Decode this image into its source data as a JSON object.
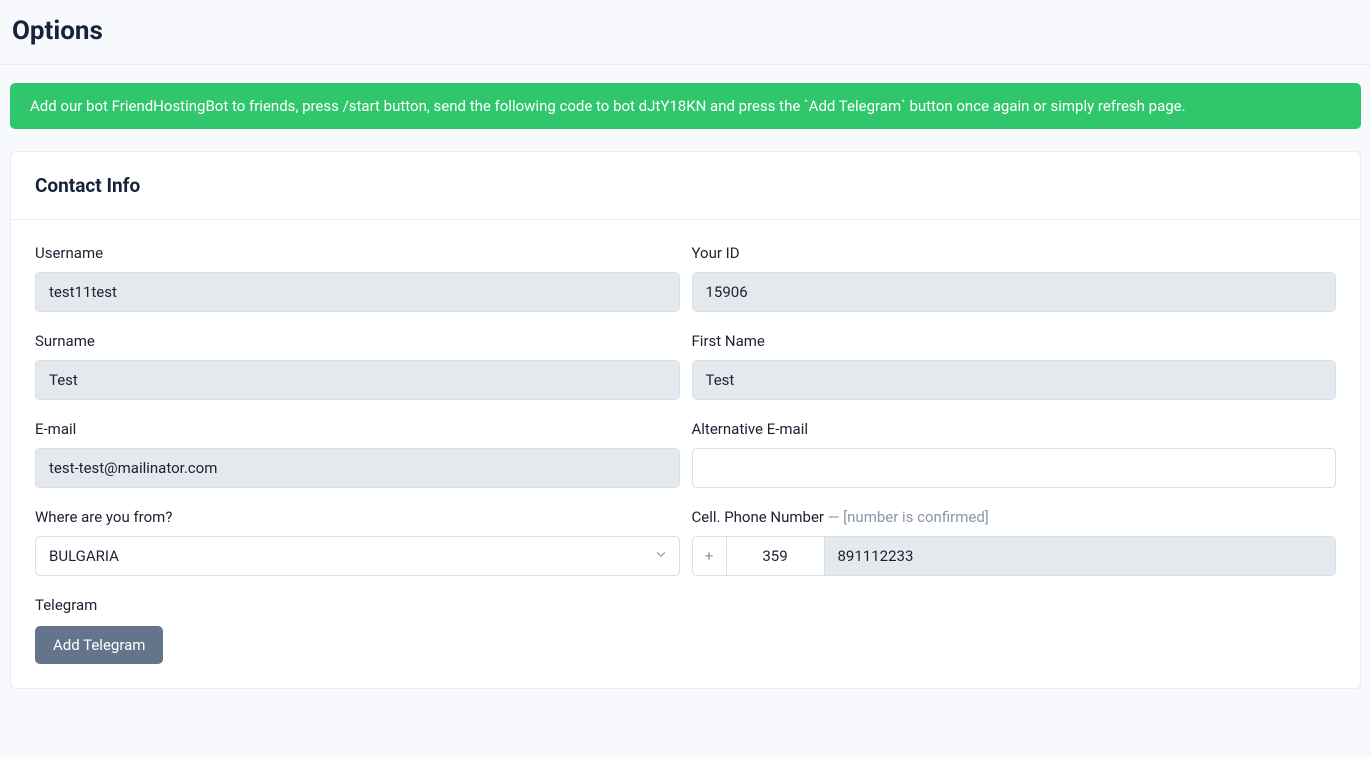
{
  "page": {
    "title": "Options"
  },
  "alert": {
    "message": "Add our bot FriendHostingBot to friends, press /start button, send the following code to bot dJtY18KN and press the `Add Telegram` button once again or simply refresh page."
  },
  "card": {
    "title": "Contact Info"
  },
  "form": {
    "username": {
      "label": "Username",
      "value": "test11test"
    },
    "your_id": {
      "label": "Your ID",
      "value": "15906"
    },
    "surname": {
      "label": "Surname",
      "value": "Test"
    },
    "first_name": {
      "label": "First Name",
      "value": "Test"
    },
    "email": {
      "label": "E-mail",
      "value": "test-test@mailinator.com"
    },
    "alt_email": {
      "label": "Alternative E-mail",
      "value": ""
    },
    "country": {
      "label": "Where are you from?",
      "value": "BULGARIA"
    },
    "phone": {
      "label": "Cell. Phone Number",
      "hint_prefix": " — ",
      "hint": "[number is confirmed]",
      "plus": "+",
      "code": "359",
      "number": "891112233"
    },
    "telegram": {
      "label": "Telegram",
      "button": "Add Telegram"
    }
  }
}
